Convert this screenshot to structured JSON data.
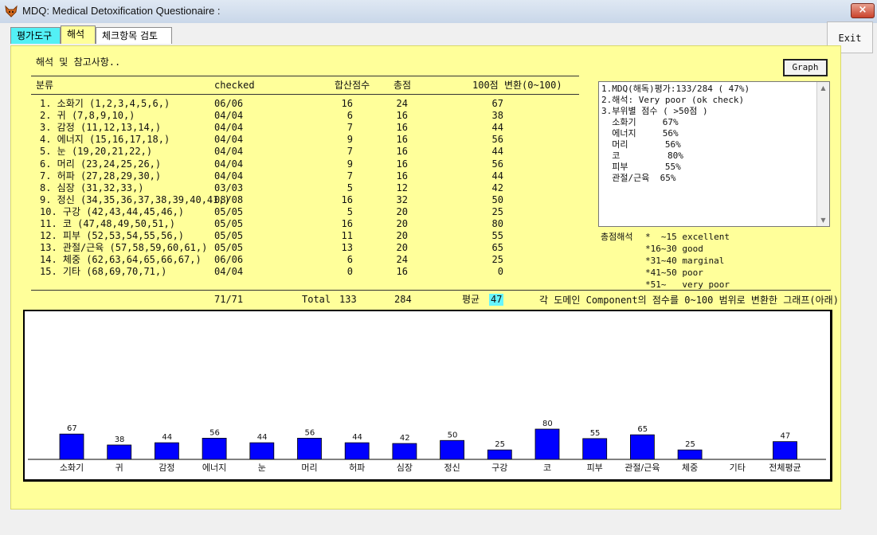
{
  "window": {
    "title": "MDQ: Medical Detoxification Questionaire :",
    "close_label": "×",
    "exit_label": "Exit"
  },
  "tabs": [
    {
      "label": "평가도구"
    },
    {
      "label": "해석"
    },
    {
      "label": "체크항목 검토"
    }
  ],
  "section_title": "해석 및 참고사항..",
  "graph_button": "Graph",
  "table": {
    "headers": [
      "분류",
      "checked",
      "합산점수",
      "총점",
      "100점 변환(0~100)"
    ],
    "rows": [
      [
        "1. 소화기 (1,2,3,4,5,6,)",
        "06/06",
        "16",
        "24",
        "67"
      ],
      [
        "2. 귀 (7,8,9,10,)",
        "04/04",
        "6",
        "16",
        "38"
      ],
      [
        "3. 감정 (11,12,13,14,)",
        "04/04",
        "7",
        "16",
        "44"
      ],
      [
        "4. 에너지 (15,16,17,18,)",
        "04/04",
        "9",
        "16",
        "56"
      ],
      [
        "5. 눈 (19,20,21,22,)",
        "04/04",
        "7",
        "16",
        "44"
      ],
      [
        "6. 머리 (23,24,25,26,)",
        "04/04",
        "9",
        "16",
        "56"
      ],
      [
        "7. 허파 (27,28,29,30,)",
        "04/04",
        "7",
        "16",
        "44"
      ],
      [
        "8. 심장 (31,32,33,)",
        "03/03",
        "5",
        "12",
        "42"
      ],
      [
        "9. 정신 (34,35,36,37,38,39,40,41,)",
        "08/08",
        "16",
        "32",
        "50"
      ],
      [
        "10. 구강 (42,43,44,45,46,)",
        "05/05",
        "5",
        "20",
        "25"
      ],
      [
        "11. 코 (47,48,49,50,51,)",
        "05/05",
        "16",
        "20",
        "80"
      ],
      [
        "12. 피부 (52,53,54,55,56,)",
        "05/05",
        "11",
        "20",
        "55"
      ],
      [
        "13. 관절/근육 (57,58,59,60,61,)",
        "05/05",
        "13",
        "20",
        "65"
      ],
      [
        "14. 체중 (62,63,64,65,66,67,)",
        "06/06",
        "6",
        "24",
        "25"
      ],
      [
        "15. 기타 (68,69,70,71,)",
        "04/04",
        "0",
        "16",
        "0"
      ]
    ],
    "footer": {
      "checked": "71/71",
      "total_label": "Total",
      "score_sum": "133",
      "total_sum": "284",
      "avg_label": "평균",
      "avg_value": "47"
    }
  },
  "result_text": [
    "1.MDQ(해독)평가:133/284 ( 47%)",
    "2.해석: Very poor (ok check)",
    "3.부위별 점수 ( >50점 )",
    "  소화기     67%",
    "  에너지     56%",
    "  머리       56%",
    "  코         80%",
    "  피부       55%",
    "  관절/근육  65%"
  ],
  "legend": {
    "title": "총점해석",
    "lines": [
      "*  ~15 excellent",
      "*16~30 good",
      "*31~40 marginal",
      "*41~50 poor",
      "*51~   very poor"
    ]
  },
  "graph_caption": "각 도메인 Component의 점수를 0~100 범위로 변환한 그래프(아래)",
  "chart_data": {
    "type": "bar",
    "categories": [
      "소화기",
      "귀",
      "감정",
      "에너지",
      "눈",
      "머리",
      "허파",
      "심장",
      "정신",
      "구강",
      "코",
      "피부",
      "관절/근육",
      "체중",
      "기타",
      "전체평균"
    ],
    "values": [
      67,
      38,
      44,
      56,
      44,
      56,
      44,
      42,
      50,
      25,
      80,
      55,
      65,
      25,
      0,
      47
    ],
    "value_labels": [
      "67",
      "38",
      "44",
      "56",
      "44",
      "56",
      "44",
      "42",
      "50",
      "25",
      "80",
      "55",
      "65",
      "25",
      "",
      "47"
    ],
    "ylim": [
      0,
      100
    ],
    "bar_color": "#0000ff",
    "grid": false
  },
  "colors": {
    "panel": "#ffff9a",
    "tab_active": "#53f0f5",
    "bar": "#0000ff"
  }
}
